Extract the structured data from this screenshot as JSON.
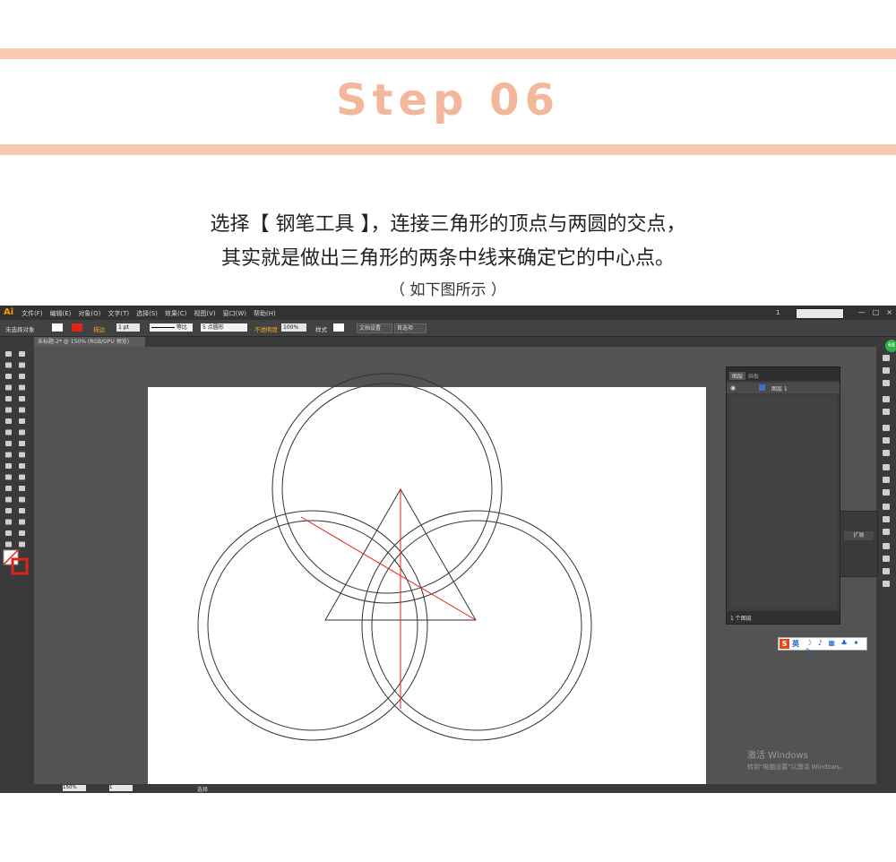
{
  "header": {
    "title": "Step 06",
    "line1": "选择【 钢笔工具 】，连接三角形的顶点与两圆的交点，",
    "line2": "其实就是做出三角形的两条中线来确定它的中心点。",
    "line3": "（ 如下图所示 ）",
    "band_color": "#f8c8b0",
    "title_color": "#f3b79b"
  },
  "app": {
    "logo": "Ai",
    "menus": [
      "文件(F)",
      "编辑(E)",
      "对象(O)",
      "文字(T)",
      "选择(S)",
      "效果(C)",
      "视图(V)",
      "窗口(W)",
      "帮助(H)"
    ],
    "page_indicator": "1",
    "window_controls": [
      "—",
      "□",
      "×"
    ],
    "control_bar": {
      "no_selection": "未选择对象",
      "stroke_label": "描边",
      "stroke_value": "1 pt",
      "profile": "等比",
      "brush": "5 点圆形",
      "opacity_label": "不透明度",
      "opacity_value": "100%",
      "style_label": "样式",
      "doc_setup": "文档设置",
      "preferences": "首选项"
    },
    "doc_tab": "未标题-2* @ 150% (RGB/GPU 预览)",
    "layers_panel": {
      "tab_layers": "图层",
      "tab_artboards": "画板",
      "layer_name": "图层 1",
      "footer": "1 个图层"
    },
    "right_panel": {
      "expand": "扩展"
    },
    "status": {
      "zoom": "150%",
      "page": "1",
      "mode": "选择"
    },
    "ime": {
      "logo": "S",
      "lang": "英",
      "icons": "☽ ♪ ▦ ♣ ✦ ✎"
    },
    "watermark": {
      "line1": "激活 Windows",
      "line2": "转到\"电脑设置\"以激活 Windows。"
    },
    "accent_color": "#ff9a00",
    "stroke_color_red": "#e2231a"
  }
}
